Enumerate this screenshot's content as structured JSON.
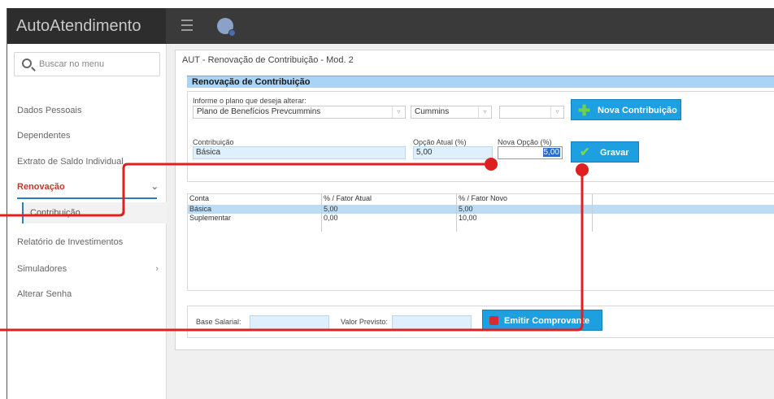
{
  "app": {
    "title": "AutoAtendimento"
  },
  "sidebar": {
    "search_placeholder": "Buscar no menu",
    "items": [
      {
        "label": "Dados Pessoais"
      },
      {
        "label": "Dependentes"
      },
      {
        "label": "Extrato de Saldo Individual"
      },
      {
        "label": "Renovação",
        "active": true
      },
      {
        "label": "Contribuição"
      },
      {
        "label": "Relatório de Investimentos"
      },
      {
        "label": "Simuladores"
      },
      {
        "label": "Alterar Senha"
      }
    ]
  },
  "main": {
    "title": "AUT - Renovação de Contribuição - Mod. 2",
    "section_header": "Renovação de Contribuição",
    "plan_label": "Informe o plano que deseja alterar:",
    "plan_value": "Plano de Benefícios Prevcummins",
    "company_value": "Cummins",
    "third_select_value": "",
    "nova_contribuicao_button": "Nova Contribuição",
    "contribuicao_label": "Contribuição",
    "contribuicao_value": "Básica",
    "opcao_atual_label": "Opção Atual (%)",
    "opcao_atual_value": "5,00",
    "nova_opcao_label": "Nova Opção (%)",
    "nova_opcao_value": "5,00",
    "gravar_button": "Gravar",
    "table": {
      "headers": [
        "Conta",
        "% / Fator Atual",
        "% / Fator Novo"
      ],
      "rows": [
        [
          "Básica",
          "5,00",
          "5,00"
        ],
        [
          "Suplementar",
          "0,00",
          "10,00"
        ]
      ]
    },
    "base_salarial_label": "Base Salarial:",
    "valor_previsto_label": "Valor Previsto:",
    "emitir_button": "Emitir Comprovante"
  },
  "colors": {
    "accent_blue": "#1e9fe0",
    "active_red": "#c0392b",
    "annotation_red": "#e02020"
  }
}
